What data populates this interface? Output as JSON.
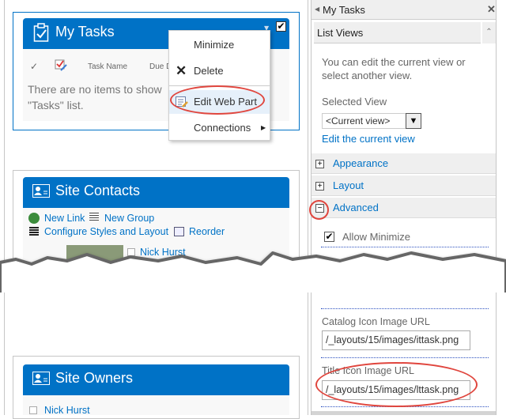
{
  "tasks_webpart": {
    "title": "My Tasks",
    "columns": [
      "Task Name",
      "Due D"
    ],
    "empty_message_line1": "There are no items to show",
    "empty_message_line2": "\"Tasks\" list."
  },
  "webpart_menu": {
    "items": [
      {
        "label": "Minimize"
      },
      {
        "label": "Delete"
      },
      {
        "label": "Edit Web Part"
      },
      {
        "label": "Connections"
      }
    ]
  },
  "contacts_webpart": {
    "title": "Site Contacts",
    "new_link": "New Link",
    "new_group": "New Group",
    "configure": "Configure Styles and Layout",
    "reorder": "Reorder",
    "person": "Nick Hurst"
  },
  "owners_webpart": {
    "title": "Site Owners",
    "person": "Nick Hurst"
  },
  "tool_pane": {
    "title": "My Tasks",
    "list_views_header": "List Views",
    "description": "You can edit the current view or select another view.",
    "selected_view_label": "Selected View",
    "selected_view_value": "<Current view>",
    "edit_view_link": "Edit the current view",
    "sections": [
      {
        "label": "Appearance",
        "expanded": false
      },
      {
        "label": "Layout",
        "expanded": false
      },
      {
        "label": "Advanced",
        "expanded": true
      }
    ],
    "allow_minimize_label": "Allow Minimize",
    "allow_minimize_checked": true,
    "catalog_icon_label": "Catalog Icon Image URL",
    "catalog_icon_value": "/_layouts/15/images/ittask.png",
    "title_icon_label": "Title Icon Image URL",
    "title_icon_value": "/_layouts/15/images/lttask.png"
  },
  "colors": {
    "accent": "#0072c6",
    "highlight": "#e0463e"
  }
}
